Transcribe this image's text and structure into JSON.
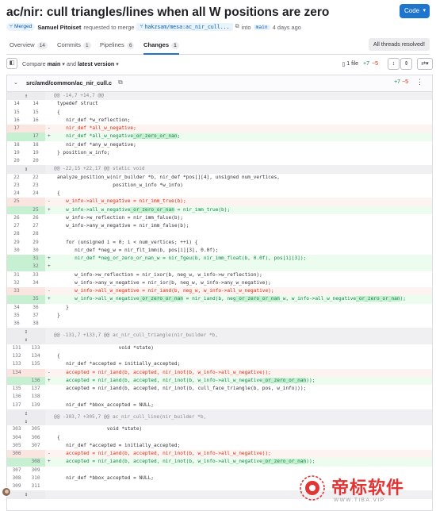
{
  "mr": {
    "title": "ac/nir: cull triangles/lines when all W positions are zero",
    "code_button": "Code",
    "status_badge": "Merged",
    "author": "Samuel Pitoiset",
    "requested_text": "requested to merge",
    "source_branch": "hakzsam/mesa:ac_nir_cull...",
    "into_text": "into",
    "target_branch": "main",
    "time": "4 days ago"
  },
  "tabs": [
    {
      "label": "Overview",
      "count": "14"
    },
    {
      "label": "Commits",
      "count": "1"
    },
    {
      "label": "Pipelines",
      "count": "6"
    },
    {
      "label": "Changes",
      "count": "1"
    }
  ],
  "threads_button": "All threads resolved!",
  "toolbar": {
    "compare_label": "Compare",
    "base": "main",
    "and_text": "and",
    "version": "latest version",
    "files": "1 file",
    "added": "+7",
    "removed": "−5"
  },
  "file": {
    "path": "src/amd/common/ac_nir_cull.c",
    "added": "+7",
    "removed": "−5"
  },
  "diff_rows": [
    {
      "t": "hunk",
      "text": "@@ -14,7 +14,7 @@",
      "icon": "↑"
    },
    {
      "t": "ctx",
      "o": "14",
      "n": "14",
      "code": "typedef struct"
    },
    {
      "t": "ctx",
      "o": "15",
      "n": "15",
      "code": "{"
    },
    {
      "t": "ctx",
      "o": "16",
      "n": "16",
      "code": "   nir_def *w_reflection;"
    },
    {
      "t": "del",
      "o": "17",
      "n": "",
      "code": "   nir_def *all_w_negative;"
    },
    {
      "t": "add",
      "o": "",
      "n": "17",
      "code": "   nir_def *all_w_negative",
      "hl": "_or_zero_or_nan",
      "tail": ";"
    },
    {
      "t": "ctx",
      "o": "18",
      "n": "18",
      "code": "   nir_def *any_w_negative;"
    },
    {
      "t": "ctx",
      "o": "19",
      "n": "19",
      "code": "} position_w_info;"
    },
    {
      "t": "ctx",
      "o": "20",
      "n": "20",
      "code": ""
    },
    {
      "t": "hunk",
      "text": "@@ -22,15 +22,17 @@ static void",
      "icon": "↕"
    },
    {
      "t": "ctx",
      "o": "22",
      "n": "22",
      "code": "analyze_position_w(nir_builder *b, nir_def *pos[][4], unsigned num_vertices,"
    },
    {
      "t": "ctx",
      "o": "23",
      "n": "23",
      "code": "                   position_w_info *w_info)"
    },
    {
      "t": "ctx",
      "o": "24",
      "n": "24",
      "code": "{"
    },
    {
      "t": "del",
      "o": "25",
      "n": "",
      "code": "   w_info->all_w_negative = nir_imm_true(b);"
    },
    {
      "t": "add",
      "o": "",
      "n": "25",
      "code": "   w_info->all_w_negative",
      "hl": "_or_zero_or_nan",
      "tail": " = nir_imm_true(b);"
    },
    {
      "t": "ctx",
      "o": "26",
      "n": "26",
      "code": "   w_info->w_reflection = nir_imm_false(b);"
    },
    {
      "t": "ctx",
      "o": "27",
      "n": "27",
      "code": "   w_info->any_w_negative = nir_imm_false(b);"
    },
    {
      "t": "ctx",
      "o": "28",
      "n": "28",
      "code": ""
    },
    {
      "t": "ctx",
      "o": "29",
      "n": "29",
      "code": "   for (unsigned i = 0; i < num_vertices; ++i) {"
    },
    {
      "t": "ctx",
      "o": "30",
      "n": "30",
      "code": "      nir_def *neg_w = nir_flt_imm(b, pos[i][3], 0.0f);"
    },
    {
      "t": "add",
      "o": "",
      "n": "31",
      "code": "      nir_def *neg_or_zero_or_nan_w = nir_fgeu(b, nir_imm_float(b, 0.0f), pos[i][3]);"
    },
    {
      "t": "add",
      "o": "",
      "n": "32",
      "code": ""
    },
    {
      "t": "ctx",
      "o": "31",
      "n": "33",
      "code": "      w_info->w_reflection = nir_ixor(b, neg_w, w_info->w_reflection);"
    },
    {
      "t": "ctx",
      "o": "32",
      "n": "34",
      "code": "      w_info->any_w_negative = nir_ior(b, neg_w, w_info->any_w_negative);"
    },
    {
      "t": "del",
      "o": "33",
      "n": "",
      "code": "      w_info->all_w_negative = nir_iand(b, neg_w, w_info->all_w_negative);"
    },
    {
      "t": "add",
      "o": "",
      "n": "35",
      "code": "      w_info->all_w_negative",
      "hl": "_or_zero_or_nan",
      "tail": " = nir_iand(b, neg",
      "hl2": "_or_zero_or_nan",
      "tail2": "_w, w_info->all_w_negative",
      "hl3": "_or_zero_or_nan",
      "tail3": ");"
    },
    {
      "t": "ctx",
      "o": "34",
      "n": "36",
      "code": "   }"
    },
    {
      "t": "ctx",
      "o": "35",
      "n": "37",
      "code": "}"
    },
    {
      "t": "ctx",
      "o": "36",
      "n": "38",
      "code": ""
    },
    {
      "t": "hunk2",
      "text": "@@ -131,7 +133,7 @@ ac_nir_cull_triangle(nir_builder *b,",
      "icon": "↕",
      "h": 20
    },
    {
      "t": "ctx",
      "o": "131",
      "n": "133",
      "code": "                     void *state)"
    },
    {
      "t": "ctx",
      "o": "132",
      "n": "134",
      "code": "{"
    },
    {
      "t": "ctx",
      "o": "133",
      "n": "135",
      "code": "   nir_def *accepted = initially_accepted;"
    },
    {
      "t": "del",
      "o": "134",
      "n": "",
      "code": "   accepted = nir_iand(b, accepted, nir_inot(b, w_info->all_w_negative));"
    },
    {
      "t": "add",
      "o": "",
      "n": "136",
      "code": "   accepted = nir_iand(b, accepted, nir_inot(b, w_info->all_w_negative",
      "hl": "_or_zero_or_nan",
      "tail": "));"
    },
    {
      "t": "ctx",
      "o": "135",
      "n": "137",
      "code": "   accepted = nir_iand(b, accepted, nir_inot(b, cull_face_triangle(b, pos, w_info)));"
    },
    {
      "t": "ctx",
      "o": "136",
      "n": "138",
      "code": ""
    },
    {
      "t": "ctx",
      "o": "137",
      "n": "139",
      "code": "   nir_def *bbox_accepted = NULL;"
    },
    {
      "t": "hunk2",
      "text": "@@ -303,7 +305,7 @@ ac_nir_cull_line(nir_builder *b,",
      "icon": "↕",
      "h": 20
    },
    {
      "t": "ctx",
      "o": "303",
      "n": "305",
      "code": "                 void *state)"
    },
    {
      "t": "ctx",
      "o": "304",
      "n": "306",
      "code": "{"
    },
    {
      "t": "ctx",
      "o": "305",
      "n": "307",
      "code": "   nir_def *accepted = initially_accepted;"
    },
    {
      "t": "del",
      "o": "306",
      "n": "",
      "code": "   accepted = nir_iand(b, accepted, nir_inot(b, w_info->all_w_negative));"
    },
    {
      "t": "add",
      "o": "",
      "n": "308",
      "code": "   accepted = nir_iand(b, accepted, nir_inot(b, w_info->all_w_negative",
      "hl": "_or_zero_or_nan",
      "tail": "));"
    },
    {
      "t": "ctx",
      "o": "307",
      "n": "309",
      "code": ""
    },
    {
      "t": "ctx",
      "o": "308",
      "n": "310",
      "code": "   nir_def *bbox_accepted = NULL;"
    },
    {
      "t": "ctx",
      "o": "309",
      "n": "311",
      "code": ""
    },
    {
      "t": "hunk",
      "text": "",
      "icon": "↕"
    }
  ],
  "watermark": {
    "text": "帝标软件",
    "url": "WWW.TIBA.VIP"
  },
  "colors": {
    "accent": "#1f75cb",
    "added_bg": "#ecfdf0",
    "removed_bg": "#fdf4f2",
    "added_text": "#108548",
    "removed_text": "#dd2b0e"
  }
}
